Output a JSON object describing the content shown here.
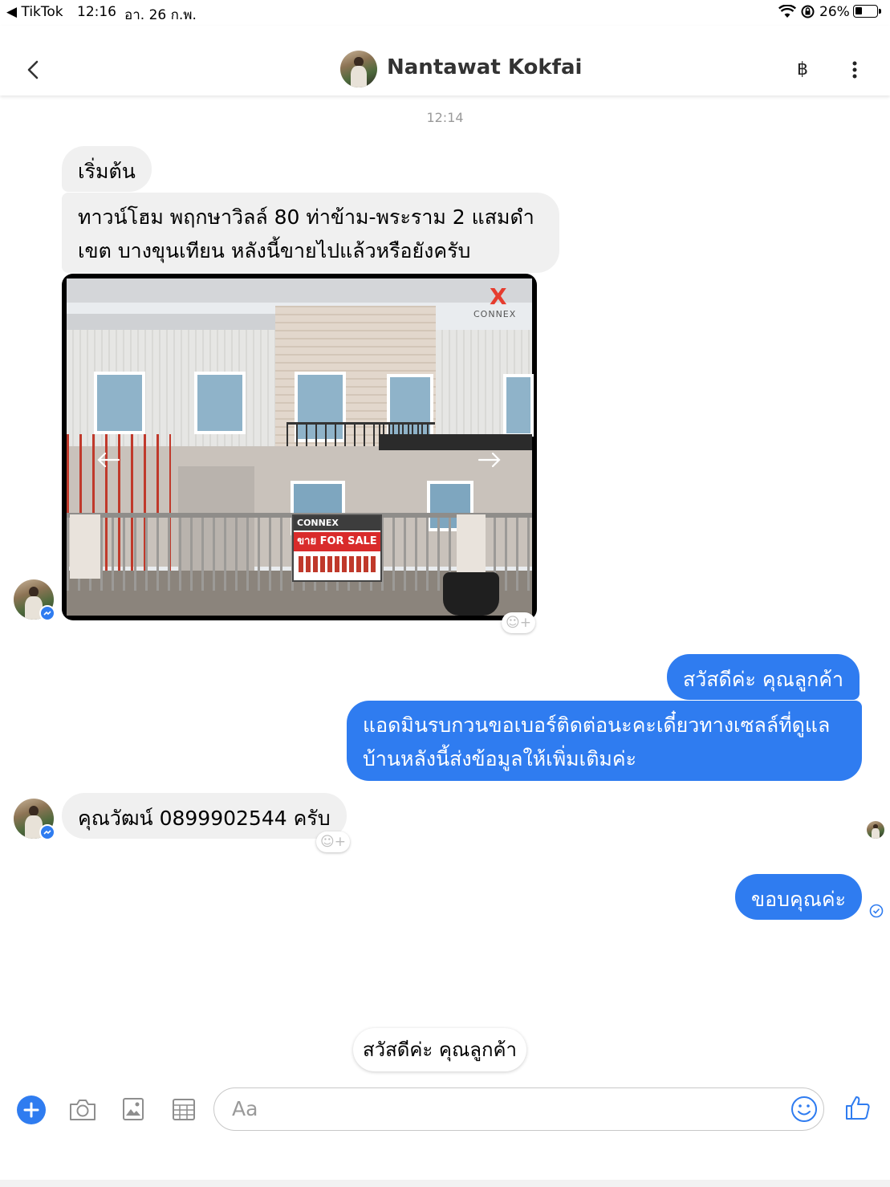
{
  "status_bar": {
    "back_app": "◀ TikTok",
    "time": "12:16",
    "date": "อา. 26 ก.พ.",
    "battery": "26%"
  },
  "header": {
    "contact_name": "Nantawat Kokfai",
    "currency_symbol": "฿"
  },
  "conversation": {
    "timestamp": "12:14",
    "msg_get_started": "เริ่มต้น",
    "msg_inquiry_line1": "ทาวน์โฮม พฤกษาวิลล์ 80 ท่าข้าม-พระราม 2 แสมดำ",
    "msg_inquiry_line2": "เขต บางขุนเทียน หลังนี้ขายไปแล้วหรือยังครับ",
    "photo": {
      "logo_text": "CONNEX",
      "sign_brand": "CONNEX",
      "sign_text": "ขาย FOR SALE"
    },
    "reply_greeting": "สวัสดีค่ะ คุณลูกค้า",
    "reply_request_line1": "แอดมินรบกวนขอเบอร์ติดต่อนะคะเดี๋ยวทางเซลล์ที่ดูแล",
    "reply_request_line2": "บ้านหลังนี้ส่งข้อมูลให้เพิ่มเติมค่ะ",
    "msg_phone": "คุณวัฒน์ 0899902544 ครับ",
    "reply_thanks": "ขอบคุณค่ะ"
  },
  "quick_reply": "สวัสดีค่ะ คุณลูกค้า",
  "composer": {
    "placeholder": "Aa"
  },
  "colors": {
    "messenger_blue": "#2f7cf0",
    "incoming_bubble": "#f0f0f0",
    "header_text": "#333333"
  }
}
